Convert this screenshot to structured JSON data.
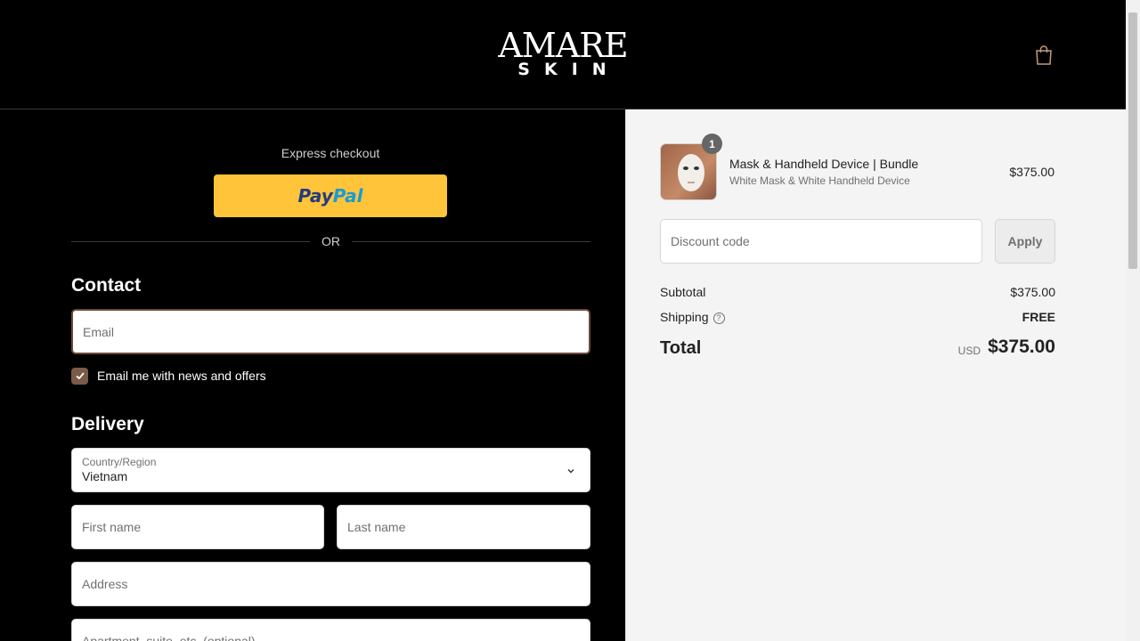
{
  "header": {
    "logo_line1": "AMARE",
    "logo_line2": "SKIN",
    "cart_icon": "shopping-bag-icon"
  },
  "express": {
    "label": "Express checkout",
    "paypal_a": "Pay",
    "paypal_b": "Pal",
    "or": "OR"
  },
  "contact": {
    "heading": "Contact",
    "email_placeholder": "Email",
    "newsletter_label": "Email me with news and offers",
    "newsletter_checked": true
  },
  "delivery": {
    "heading": "Delivery",
    "country_label": "Country/Region",
    "country_value": "Vietnam",
    "first_name": "First name",
    "last_name": "Last name",
    "address": "Address",
    "apartment": "Apartment, suite, etc. (optional)"
  },
  "summary": {
    "badge": "1",
    "product_name": "Mask & Handheld Device | Bundle",
    "product_variant": "White Mask & White Handheld Device",
    "product_price": "$375.00",
    "discount_placeholder": "Discount code",
    "apply_label": "Apply",
    "subtotal_label": "Subtotal",
    "subtotal_value": "$375.00",
    "shipping_label": "Shipping",
    "shipping_value": "FREE",
    "total_label": "Total",
    "currency": "USD",
    "total_value": "$375.00"
  },
  "colors": {
    "paypal": "#ffc439",
    "accent_brown": "#7b5a4a",
    "summary_bg": "#f4f4f4"
  }
}
